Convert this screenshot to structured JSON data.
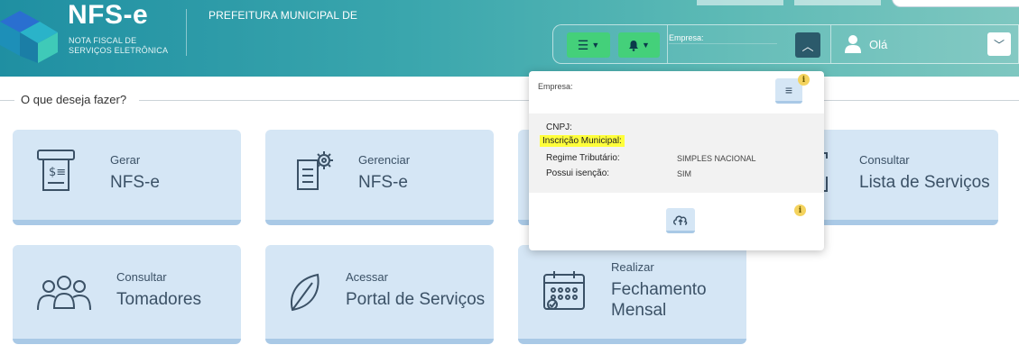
{
  "header": {
    "logo_title": "NFS-e",
    "logo_sub1": "NOTA FISCAL DE",
    "logo_sub2": "SERVIÇOS ELETRÔNICA",
    "prefeitura": "PREFEITURA MUNICIPAL DE",
    "empresa_label": "Empresa:",
    "greeting": "Olá"
  },
  "section": {
    "legend": "O que deseja fazer?"
  },
  "cards": [
    {
      "line1": "Gerar",
      "line2": "NFS-e",
      "icon": "invoice-terminal-icon"
    },
    {
      "line1": "Gerenciar",
      "line2": "NFS-e",
      "icon": "document-gear-icon"
    },
    {
      "line1": "Consultar",
      "line2": "Lista de Serviços",
      "icon": "clipboard-icon"
    },
    {
      "line1": "Consultar",
      "line2": "Tomadores",
      "icon": "people-group-icon"
    },
    {
      "line1": "Acessar",
      "line2": "Portal de Serviços",
      "icon": "leaf-icon"
    },
    {
      "line1": "Realizar",
      "line2": "Fechamento",
      "line3": "Mensal",
      "icon": "calendar-icon"
    }
  ],
  "dropdown": {
    "empresa_label": "Empresa:",
    "cnpj_label": "CNPJ:",
    "inscricao_label": "Inscrição Municipal:",
    "regime_label": "Regime Tributário:",
    "regime_value": "SIMPLES NACIONAL",
    "isencao_label": "Possui isenção:",
    "isencao_value": "SIM"
  },
  "colors": {
    "header_start": "#1f8fa2",
    "action_green": "#44d07a",
    "card_bg": "#d5e6f5",
    "card_border": "#a9c9e6",
    "highlight": "#ffff3b"
  }
}
